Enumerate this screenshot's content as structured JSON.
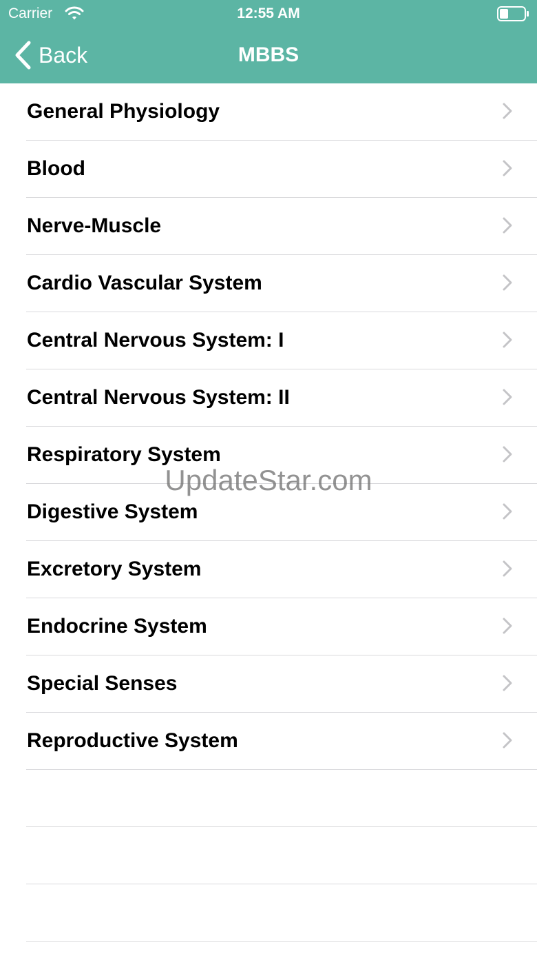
{
  "status_bar": {
    "carrier": "Carrier",
    "time": "12:55 AM"
  },
  "nav": {
    "back_label": "Back",
    "title": "MBBS"
  },
  "list": {
    "items": [
      {
        "label": "General Physiology"
      },
      {
        "label": "Blood"
      },
      {
        "label": "Nerve-Muscle"
      },
      {
        "label": "Cardio Vascular System"
      },
      {
        "label": "Central Nervous System: I"
      },
      {
        "label": "Central Nervous System: II"
      },
      {
        "label": "Respiratory System"
      },
      {
        "label": "Digestive System"
      },
      {
        "label": "Excretory System"
      },
      {
        "label": "Endocrine System"
      },
      {
        "label": "Special Senses"
      },
      {
        "label": "Reproductive System"
      }
    ]
  },
  "watermark": "UpdateStar.com",
  "colors": {
    "nav_background": "#5cb5a4",
    "nav_text": "#ffffff",
    "separator": "#d9d9dc",
    "chevron": "#c4c4c7"
  },
  "icons": {
    "wifi": "wifi-icon",
    "battery": "battery-icon",
    "back": "chevron-left-icon",
    "disclosure": "chevron-right-icon"
  }
}
